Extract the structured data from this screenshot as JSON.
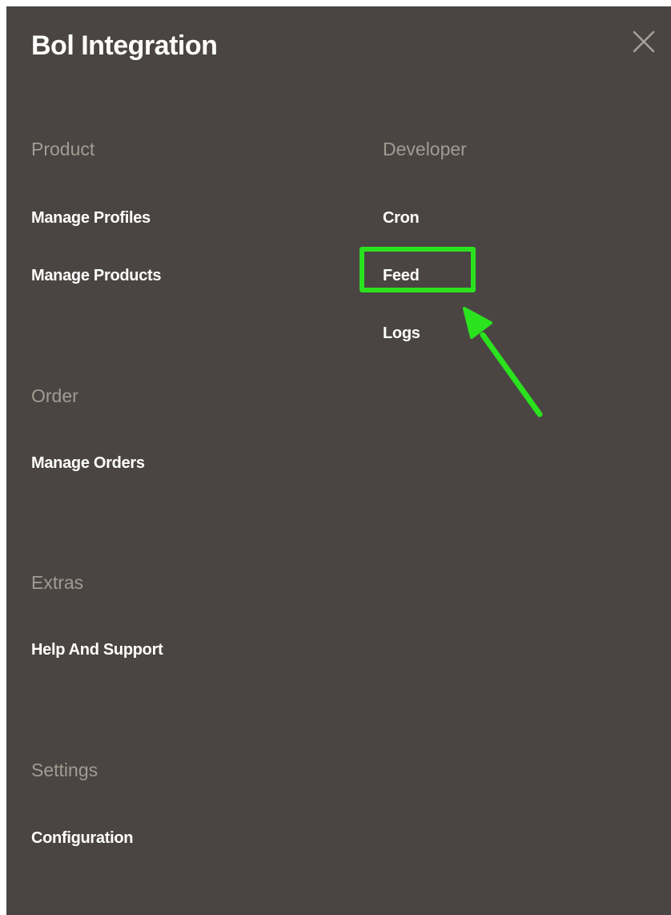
{
  "panel": {
    "title": "Bol Integration",
    "close_icon": "close-icon"
  },
  "sections": {
    "product": {
      "heading": "Product",
      "items": [
        "Manage Profiles",
        "Manage Products"
      ]
    },
    "developer": {
      "heading": "Developer",
      "items": [
        "Cron",
        "Feed",
        "Logs"
      ]
    },
    "order": {
      "heading": "Order",
      "items": [
        "Manage Orders"
      ]
    },
    "extras": {
      "heading": "Extras",
      "items": [
        "Help And Support"
      ]
    },
    "settings": {
      "heading": "Settings",
      "items": [
        "Configuration"
      ]
    }
  },
  "annotation": {
    "highlighted_item": "Feed",
    "color": "#2be21f"
  },
  "colors": {
    "panel_background": "#4a4542",
    "heading": "#a39a92",
    "link": "#ffffff"
  }
}
